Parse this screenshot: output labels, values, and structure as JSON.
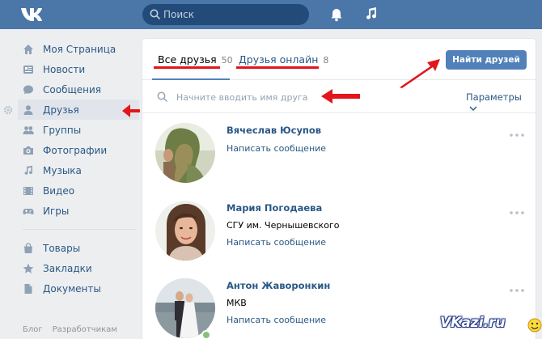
{
  "header": {
    "search_placeholder": "Поиск"
  },
  "sidebar": {
    "items": [
      {
        "label": "Моя Страница",
        "icon": "home-icon"
      },
      {
        "label": "Новости",
        "icon": "news-icon"
      },
      {
        "label": "Сообщения",
        "icon": "messages-icon"
      },
      {
        "label": "Друзья",
        "icon": "friends-icon",
        "active": true
      },
      {
        "label": "Группы",
        "icon": "groups-icon"
      },
      {
        "label": "Фотографии",
        "icon": "camera-icon"
      },
      {
        "label": "Музыка",
        "icon": "music-icon"
      },
      {
        "label": "Видео",
        "icon": "video-icon"
      },
      {
        "label": "Игры",
        "icon": "gamepad-icon"
      }
    ],
    "items2": [
      {
        "label": "Товары",
        "icon": "bag-icon"
      },
      {
        "label": "Закладки",
        "icon": "star-icon"
      },
      {
        "label": "Документы",
        "icon": "document-icon"
      }
    ],
    "footer": [
      "Блог",
      "Разработчикам"
    ]
  },
  "tabs": {
    "all_label": "Все друзья",
    "all_count": "50",
    "online_label": "Друзья онлайн",
    "online_count": "8"
  },
  "find_button": "Найти друзей",
  "filter": {
    "placeholder": "Начните вводить имя друга",
    "params_label": "Параметры"
  },
  "friends": [
    {
      "name": "Вячеслав Юсупов",
      "sub": "",
      "action": "Написать сообщение",
      "online": false
    },
    {
      "name": "Мария Погодаева",
      "sub": "СГУ им. Чернышевского",
      "action": "Написать сообщение",
      "online": false
    },
    {
      "name": "Антон Жаворонкин",
      "sub": "МКВ",
      "action": "Написать сообщение",
      "online": true
    }
  ],
  "watermark": "VKazi.ru",
  "colors": {
    "header": "#4a76a8",
    "link": "#2a5885",
    "button": "#5181b8",
    "annotation_red": "#e3161b"
  }
}
